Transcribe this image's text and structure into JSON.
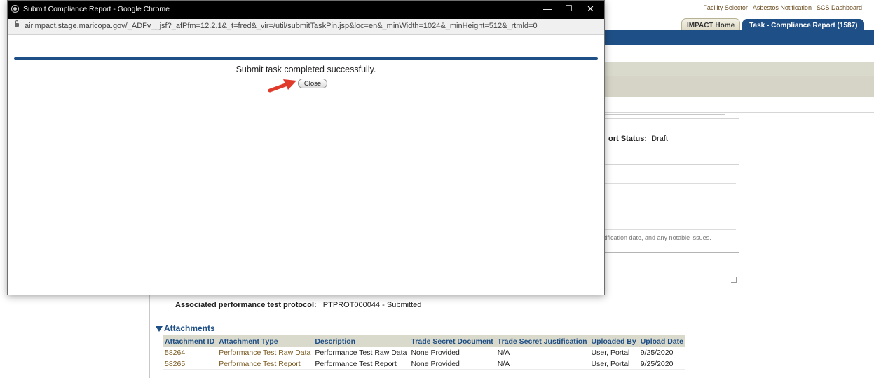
{
  "top_links": [
    "Facility Selector",
    "Asbestos Notification",
    "SCS Dashboard"
  ],
  "tabs": [
    {
      "label": "IMPACT Home"
    },
    {
      "label": "Task - Compliance Report (1587)"
    }
  ],
  "report_status": {
    "label": "ort Status:",
    "value": "Draft"
  },
  "notice_text": "tification date, and any notable issues.",
  "protocol": {
    "label": "Associated performance test protocol:",
    "value": "PTPROT000044 - Submitted"
  },
  "attachments": {
    "title": "Attachments",
    "columns": [
      "Attachment ID",
      "Attachment Type",
      "Description",
      "Trade Secret Document",
      "Trade Secret Justification",
      "Uploaded By",
      "Upload Date"
    ],
    "rows": [
      {
        "id": "58264",
        "type": "Performance Test Raw Data",
        "description": "Performance Test Raw Data",
        "trade_secret_doc": "None Provided",
        "justification": "N/A",
        "uploaded_by": "User, Portal",
        "date": "9/25/2020"
      },
      {
        "id": "58265",
        "type": "Performance Test Report",
        "description": "Performance Test Report",
        "trade_secret_doc": "None Provided",
        "justification": "N/A",
        "uploaded_by": "User, Portal",
        "date": "9/25/2020"
      }
    ]
  },
  "popup": {
    "title": "Submit Compliance Report - Google Chrome",
    "url": "airimpact.stage.maricopa.gov/_ADFv__jsf?_afPfm=12.2.1&_t=fred&_vir=/util/submitTaskPin.jsp&loc=en&_minWidth=1024&_minHeight=512&_rtmld=0",
    "message": "Submit task completed successfully.",
    "close_label": "Close",
    "window_controls": {
      "minimize": "—",
      "maximize": "☐",
      "close": "✕"
    }
  },
  "colors": {
    "brand_blue": "#1e4f86",
    "link_brown": "#7a5a20",
    "annotation_arrow": "#e03a2a"
  },
  "icons": [
    "chrome-icon",
    "lock-icon",
    "collapse-triangle-icon",
    "red-arrow-icon",
    "resize-grip-icon"
  ]
}
